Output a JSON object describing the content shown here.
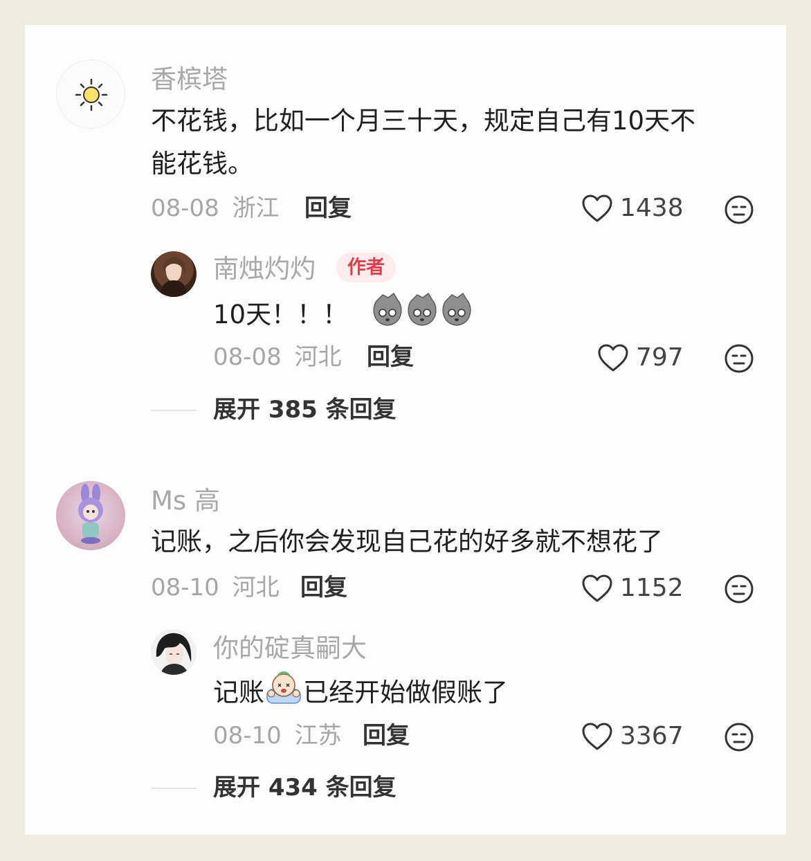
{
  "comments": [
    {
      "username": "香槟塔",
      "text_line1": "不花钱，比如一个月三十天，规定自己有10天不",
      "text_line2": "能花钱。",
      "date": "08-08",
      "location": "浙江",
      "reply_label": "回复",
      "likes": "1438",
      "reply": {
        "username": "南烛灼灼",
        "badge": "作者",
        "text": "10天！！！",
        "date": "08-08",
        "location": "河北",
        "reply_label": "回复",
        "likes": "797"
      },
      "expand_label": "展开 385 条回复"
    },
    {
      "username": "Ms 高",
      "text_line1": "记账，之后你会发现自己花的好多就不想花了",
      "date": "08-10",
      "location": "河北",
      "reply_label": "回复",
      "likes": "1152",
      "reply": {
        "username": "你的碇真嗣大",
        "text_before": "记账",
        "text_after": "已经开始做假账了",
        "date": "08-10",
        "location": "江苏",
        "reply_label": "回复",
        "likes": "3367"
      },
      "expand_label": "展开 434 条回复"
    }
  ],
  "icons": {
    "like": "heart-outline-icon",
    "dislike": "neutral-face-icon",
    "avatar_1": "sun-icon",
    "emoji_1": "bag-face-emoji",
    "emoji_2": "crying-face-emoji"
  },
  "colors": {
    "background": "#efede0",
    "card": "#fdfdfd",
    "author_badge_bg": "#fdeceb",
    "author_badge_text": "#e23d4a"
  }
}
